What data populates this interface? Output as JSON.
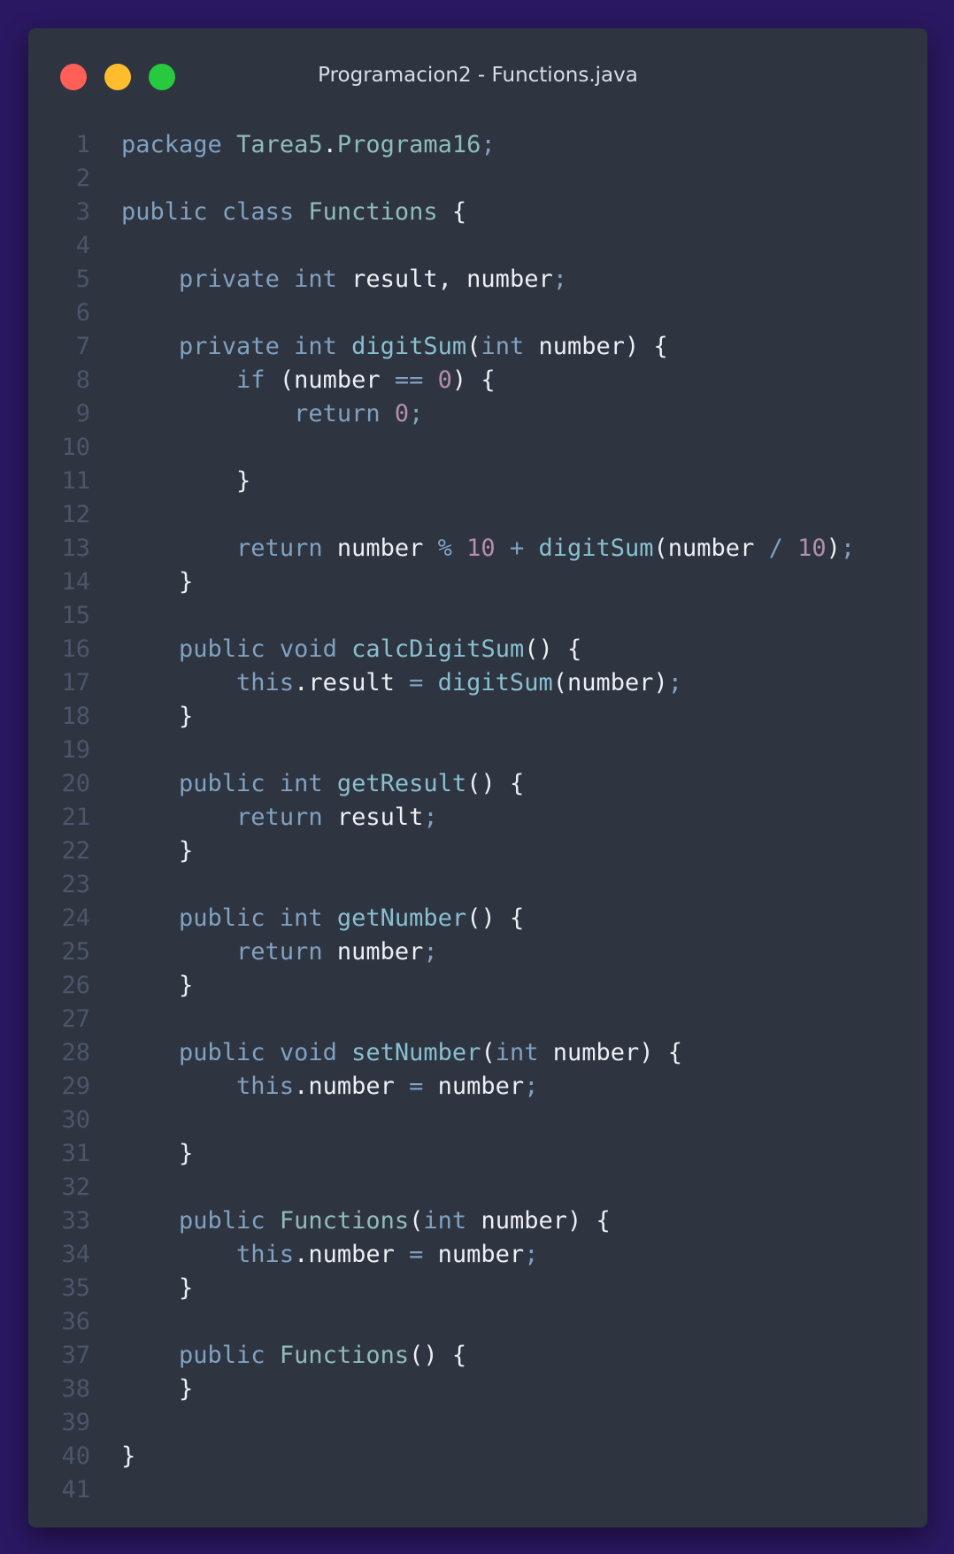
{
  "window": {
    "title": "Programacion2 - Functions.java"
  },
  "colors": {
    "background": "#2b1862",
    "editor": "#2e3440",
    "keyword": "#81a1c1",
    "type": "#8fbcbb",
    "function": "#88c0d0",
    "number": "#b48ead",
    "text": "#eceff4",
    "line_number": "#4c566a",
    "close": "#ff5f56",
    "minimize": "#ffbd2e",
    "maximize": "#27c93f"
  },
  "code_lines": [
    [
      [
        "k",
        "package"
      ],
      [
        "v",
        " "
      ],
      [
        "t",
        "Tarea5"
      ],
      [
        "v",
        "."
      ],
      [
        "t",
        "Programa16"
      ],
      [
        "p",
        ";"
      ]
    ],
    [],
    [
      [
        "k",
        "public"
      ],
      [
        "v",
        " "
      ],
      [
        "k",
        "class"
      ],
      [
        "v",
        " "
      ],
      [
        "t",
        "Functions"
      ],
      [
        "v",
        " {"
      ]
    ],
    [],
    [
      [
        "v",
        "    "
      ],
      [
        "k",
        "private"
      ],
      [
        "v",
        " "
      ],
      [
        "k",
        "int"
      ],
      [
        "v",
        " result, number"
      ],
      [
        "p",
        ";"
      ]
    ],
    [],
    [
      [
        "v",
        "    "
      ],
      [
        "k",
        "private"
      ],
      [
        "v",
        " "
      ],
      [
        "k",
        "int"
      ],
      [
        "v",
        " "
      ],
      [
        "f",
        "digitSum"
      ],
      [
        "v",
        "("
      ],
      [
        "k",
        "int"
      ],
      [
        "v",
        " number) {"
      ]
    ],
    [
      [
        "v",
        "        "
      ],
      [
        "k",
        "if"
      ],
      [
        "v",
        " (number "
      ],
      [
        "p",
        "=="
      ],
      [
        "v",
        " "
      ],
      [
        "n",
        "0"
      ],
      [
        "v",
        ") {"
      ]
    ],
    [
      [
        "v",
        "            "
      ],
      [
        "k",
        "return"
      ],
      [
        "v",
        " "
      ],
      [
        "n",
        "0"
      ],
      [
        "p",
        ";"
      ]
    ],
    [],
    [
      [
        "v",
        "        }"
      ]
    ],
    [],
    [
      [
        "v",
        "        "
      ],
      [
        "k",
        "return"
      ],
      [
        "v",
        " number "
      ],
      [
        "p",
        "%"
      ],
      [
        "v",
        " "
      ],
      [
        "n",
        "10"
      ],
      [
        "v",
        " "
      ],
      [
        "p",
        "+"
      ],
      [
        "v",
        " "
      ],
      [
        "f",
        "digitSum"
      ],
      [
        "v",
        "(number "
      ],
      [
        "p",
        "/"
      ],
      [
        "v",
        " "
      ],
      [
        "n",
        "10"
      ],
      [
        "v",
        ")"
      ],
      [
        "p",
        ";"
      ]
    ],
    [
      [
        "v",
        "    }"
      ]
    ],
    [],
    [
      [
        "v",
        "    "
      ],
      [
        "k",
        "public"
      ],
      [
        "v",
        " "
      ],
      [
        "k",
        "void"
      ],
      [
        "v",
        " "
      ],
      [
        "f",
        "calcDigitSum"
      ],
      [
        "v",
        "() {"
      ]
    ],
    [
      [
        "v",
        "        "
      ],
      [
        "k",
        "this"
      ],
      [
        "v",
        ".result "
      ],
      [
        "p",
        "="
      ],
      [
        "v",
        " "
      ],
      [
        "f",
        "digitSum"
      ],
      [
        "v",
        "(number)"
      ],
      [
        "p",
        ";"
      ]
    ],
    [
      [
        "v",
        "    }"
      ]
    ],
    [],
    [
      [
        "v",
        "    "
      ],
      [
        "k",
        "public"
      ],
      [
        "v",
        " "
      ],
      [
        "k",
        "int"
      ],
      [
        "v",
        " "
      ],
      [
        "f",
        "getResult"
      ],
      [
        "v",
        "() {"
      ]
    ],
    [
      [
        "v",
        "        "
      ],
      [
        "k",
        "return"
      ],
      [
        "v",
        " result"
      ],
      [
        "p",
        ";"
      ]
    ],
    [
      [
        "v",
        "    }"
      ]
    ],
    [],
    [
      [
        "v",
        "    "
      ],
      [
        "k",
        "public"
      ],
      [
        "v",
        " "
      ],
      [
        "k",
        "int"
      ],
      [
        "v",
        " "
      ],
      [
        "f",
        "getNumber"
      ],
      [
        "v",
        "() {"
      ]
    ],
    [
      [
        "v",
        "        "
      ],
      [
        "k",
        "return"
      ],
      [
        "v",
        " number"
      ],
      [
        "p",
        ";"
      ]
    ],
    [
      [
        "v",
        "    }"
      ]
    ],
    [],
    [
      [
        "v",
        "    "
      ],
      [
        "k",
        "public"
      ],
      [
        "v",
        " "
      ],
      [
        "k",
        "void"
      ],
      [
        "v",
        " "
      ],
      [
        "f",
        "setNumber"
      ],
      [
        "v",
        "("
      ],
      [
        "k",
        "int"
      ],
      [
        "v",
        " number) {"
      ]
    ],
    [
      [
        "v",
        "        "
      ],
      [
        "k",
        "this"
      ],
      [
        "v",
        ".number "
      ],
      [
        "p",
        "="
      ],
      [
        "v",
        " number"
      ],
      [
        "p",
        ";"
      ]
    ],
    [],
    [
      [
        "v",
        "    }"
      ]
    ],
    [],
    [
      [
        "v",
        "    "
      ],
      [
        "k",
        "public"
      ],
      [
        "v",
        " "
      ],
      [
        "t",
        "Functions"
      ],
      [
        "v",
        "("
      ],
      [
        "k",
        "int"
      ],
      [
        "v",
        " number) {"
      ]
    ],
    [
      [
        "v",
        "        "
      ],
      [
        "k",
        "this"
      ],
      [
        "v",
        ".number "
      ],
      [
        "p",
        "="
      ],
      [
        "v",
        " number"
      ],
      [
        "p",
        ";"
      ]
    ],
    [
      [
        "v",
        "    }"
      ]
    ],
    [],
    [
      [
        "v",
        "    "
      ],
      [
        "k",
        "public"
      ],
      [
        "v",
        " "
      ],
      [
        "t",
        "Functions"
      ],
      [
        "v",
        "() {"
      ]
    ],
    [
      [
        "v",
        "    }"
      ]
    ],
    [],
    [
      [
        "v",
        "}"
      ]
    ],
    []
  ]
}
